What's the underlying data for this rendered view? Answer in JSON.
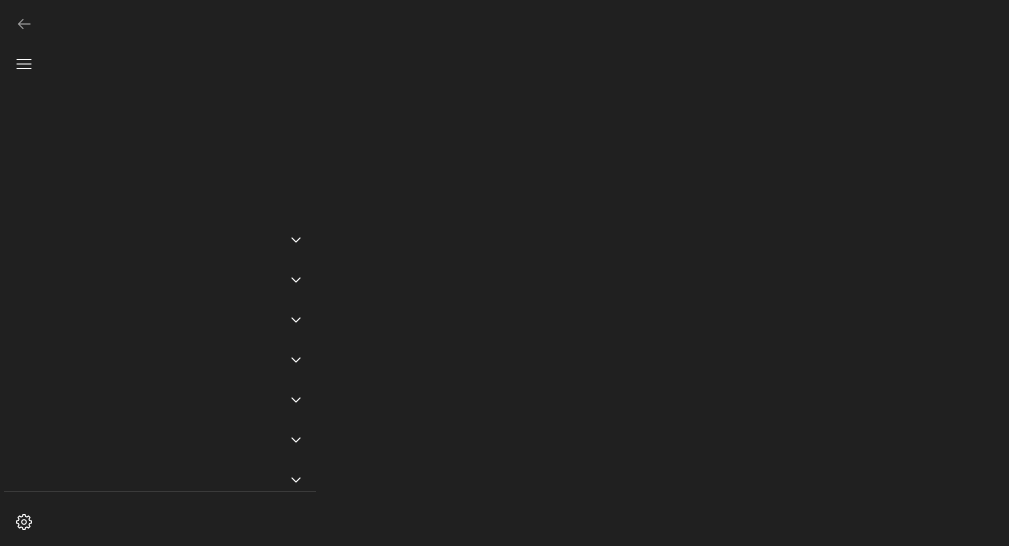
{
  "window": {
    "background": "#202020",
    "foreground": "#ffffff"
  },
  "header": {
    "back_icon": "arrow-left-icon",
    "menu_icon": "hamburger-menu-icon"
  },
  "nav": {
    "groups": [
      {
        "label": "",
        "icon": "chevron-down-icon"
      },
      {
        "label": "",
        "icon": "chevron-down-icon"
      },
      {
        "label": "",
        "icon": "chevron-down-icon"
      },
      {
        "label": "",
        "icon": "chevron-down-icon"
      },
      {
        "label": "",
        "icon": "chevron-down-icon"
      },
      {
        "label": "",
        "icon": "chevron-down-icon"
      },
      {
        "label": "",
        "icon": "chevron-down-icon"
      }
    ]
  },
  "footer": {
    "settings_icon": "gear-icon"
  }
}
